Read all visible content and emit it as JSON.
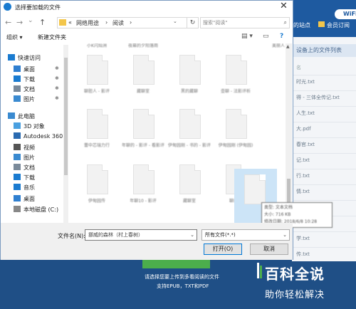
{
  "dialog": {
    "title": "选择要加载的文件",
    "close": "✕",
    "nav": {
      "back": "←",
      "forward": "→",
      "dropdown": "⌄",
      "up": "↑"
    },
    "breadcrumb": [
      "«",
      "网络用途",
      "›",
      "阅读",
      "›"
    ],
    "search_placeholder": "搜索\"阅读\"",
    "toolbar": {
      "organize": "组织 ▾",
      "new_folder": "新建文件夹"
    },
    "sidebar": [
      {
        "label": "快速访问",
        "icon": "star-icon",
        "color": "#1a7bd0"
      },
      {
        "label": "桌面",
        "icon": "desktop-icon",
        "color": "#2f7fd0",
        "pinned": true
      },
      {
        "label": "下载",
        "icon": "download-icon",
        "color": "#1a7bd0",
        "pinned": true
      },
      {
        "label": "文档",
        "icon": "document-icon",
        "color": "#7a8a9a",
        "pinned": true
      },
      {
        "label": "图片",
        "icon": "pictures-icon",
        "color": "#3a8ad0",
        "pinned": true
      },
      {
        "label": "此电脑",
        "icon": "computer-icon",
        "color": "#3a8ad0"
      },
      {
        "label": "3D 对象",
        "icon": "3d-objects-icon",
        "color": "#4aa0e0"
      },
      {
        "label": "Autodesk 360",
        "icon": "autodesk-icon",
        "color": "#2a6ab0"
      },
      {
        "label": "视频",
        "icon": "video-icon",
        "color": "#555555"
      },
      {
        "label": "图片",
        "icon": "pictures-icon",
        "color": "#3a8ad0"
      },
      {
        "label": "文档",
        "icon": "document-icon",
        "color": "#7a8a9a"
      },
      {
        "label": "下载",
        "icon": "download-icon",
        "color": "#1a7bd0"
      },
      {
        "label": "音乐",
        "icon": "music-icon",
        "color": "#1a7bd0"
      },
      {
        "label": "桌面",
        "icon": "desktop-icon",
        "color": "#2f7fd0"
      },
      {
        "label": "本地磁盘 (C:)",
        "icon": "drive-icon",
        "color": "#888888"
      }
    ],
    "files_top_row": [
      "小K闪灿洲",
      "夜幕的夕阳落雨",
      "",
      "",
      "美丽人"
    ],
    "files": [
      "聊胆人 - 影评",
      "藏聊室",
      "黑的藏聊",
      "壶聊 - 法影评析",
      "蕾中芯瑞力行",
      "年聊的 - 影评 - 看影评",
      "伊甸园刚 - 书的 - 影评",
      "伊甸园刚 (伊甸园)",
      "伊甸园传",
      "年聊10 - 影评",
      "藏聊室",
      "聊的语"
    ],
    "tooltip": {
      "type": "类型: 文本文档",
      "size": "大小: 716 KB",
      "modified": "修改日期: 2018/6/8 10:28"
    },
    "filename_label": "文件名(N):",
    "filename_value": "挪威的森林（村上春树）",
    "filetype_value": "所有文件(*.*)",
    "open_button": "打开(O)",
    "cancel_button": "取消"
  },
  "background": {
    "top_left_text": "的站点",
    "top_right_text": "会员订阅",
    "wifi_text": "WiFi",
    "list_header": "设备上的文件列表",
    "list_subheader": "名",
    "rows": [
      "时光.txt",
      "得 - 三体全传记.txt",
      "人生.txt",
      "大.pdf",
      "春官.txt",
      "记.txt",
      "行.txt",
      "情.txt",
      "划复 - 青地.txt",
      "夫.txt",
      "学.txt",
      "传.txt",
      "记.pdf",
      "读.txt",
      "该.txt"
    ],
    "upload_line1": "请选择您要上传到多看阅读的文件",
    "upload_line2": "支持EPUB，TXT和PDF"
  },
  "watermark": {
    "line1": "百科全说",
    "line2": "助你轻松解决"
  }
}
